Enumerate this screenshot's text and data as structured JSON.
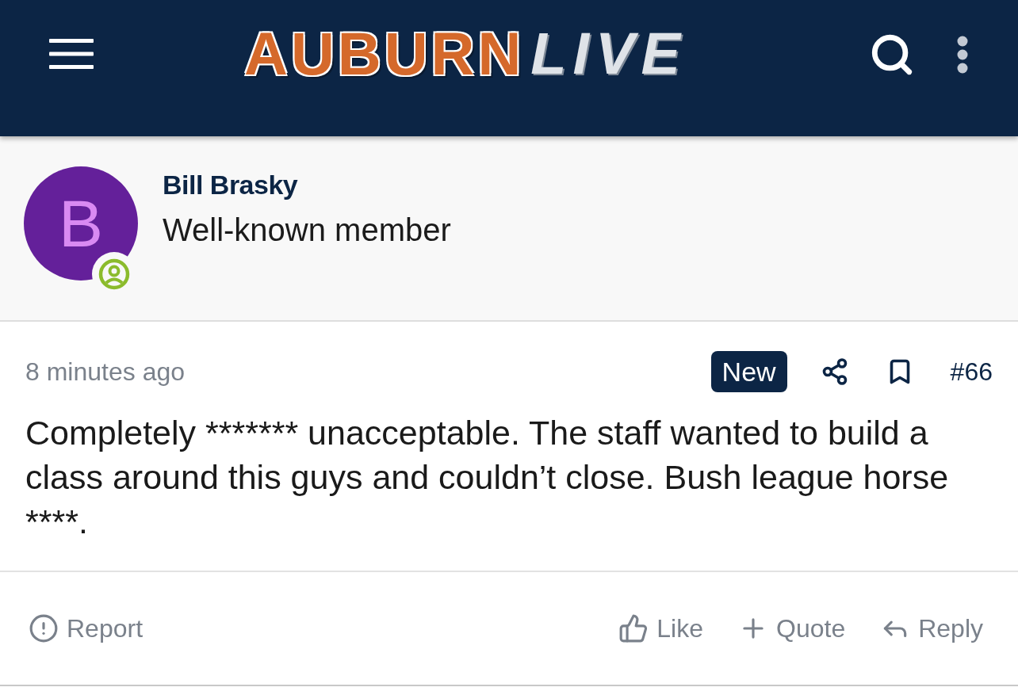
{
  "header": {
    "logo": {
      "primary": "AUBURN",
      "secondary": "LIVE"
    }
  },
  "author": {
    "avatar_letter": "B",
    "online": true,
    "name": "Bill Brasky",
    "title": "Well-known member"
  },
  "post": {
    "time": "8 minutes ago",
    "badge": "New",
    "number": "#66",
    "body": "Completely ******* unacceptable. The staff wanted to build a class around this guys and couldn’t close. Bush league horse ****."
  },
  "actions": {
    "left": [
      {
        "label": "Report",
        "kind": "report"
      }
    ],
    "right": [
      {
        "label": "Like",
        "kind": "like"
      },
      {
        "label": "Quote",
        "kind": "quote"
      },
      {
        "label": "Reply",
        "kind": "reply"
      }
    ]
  }
}
